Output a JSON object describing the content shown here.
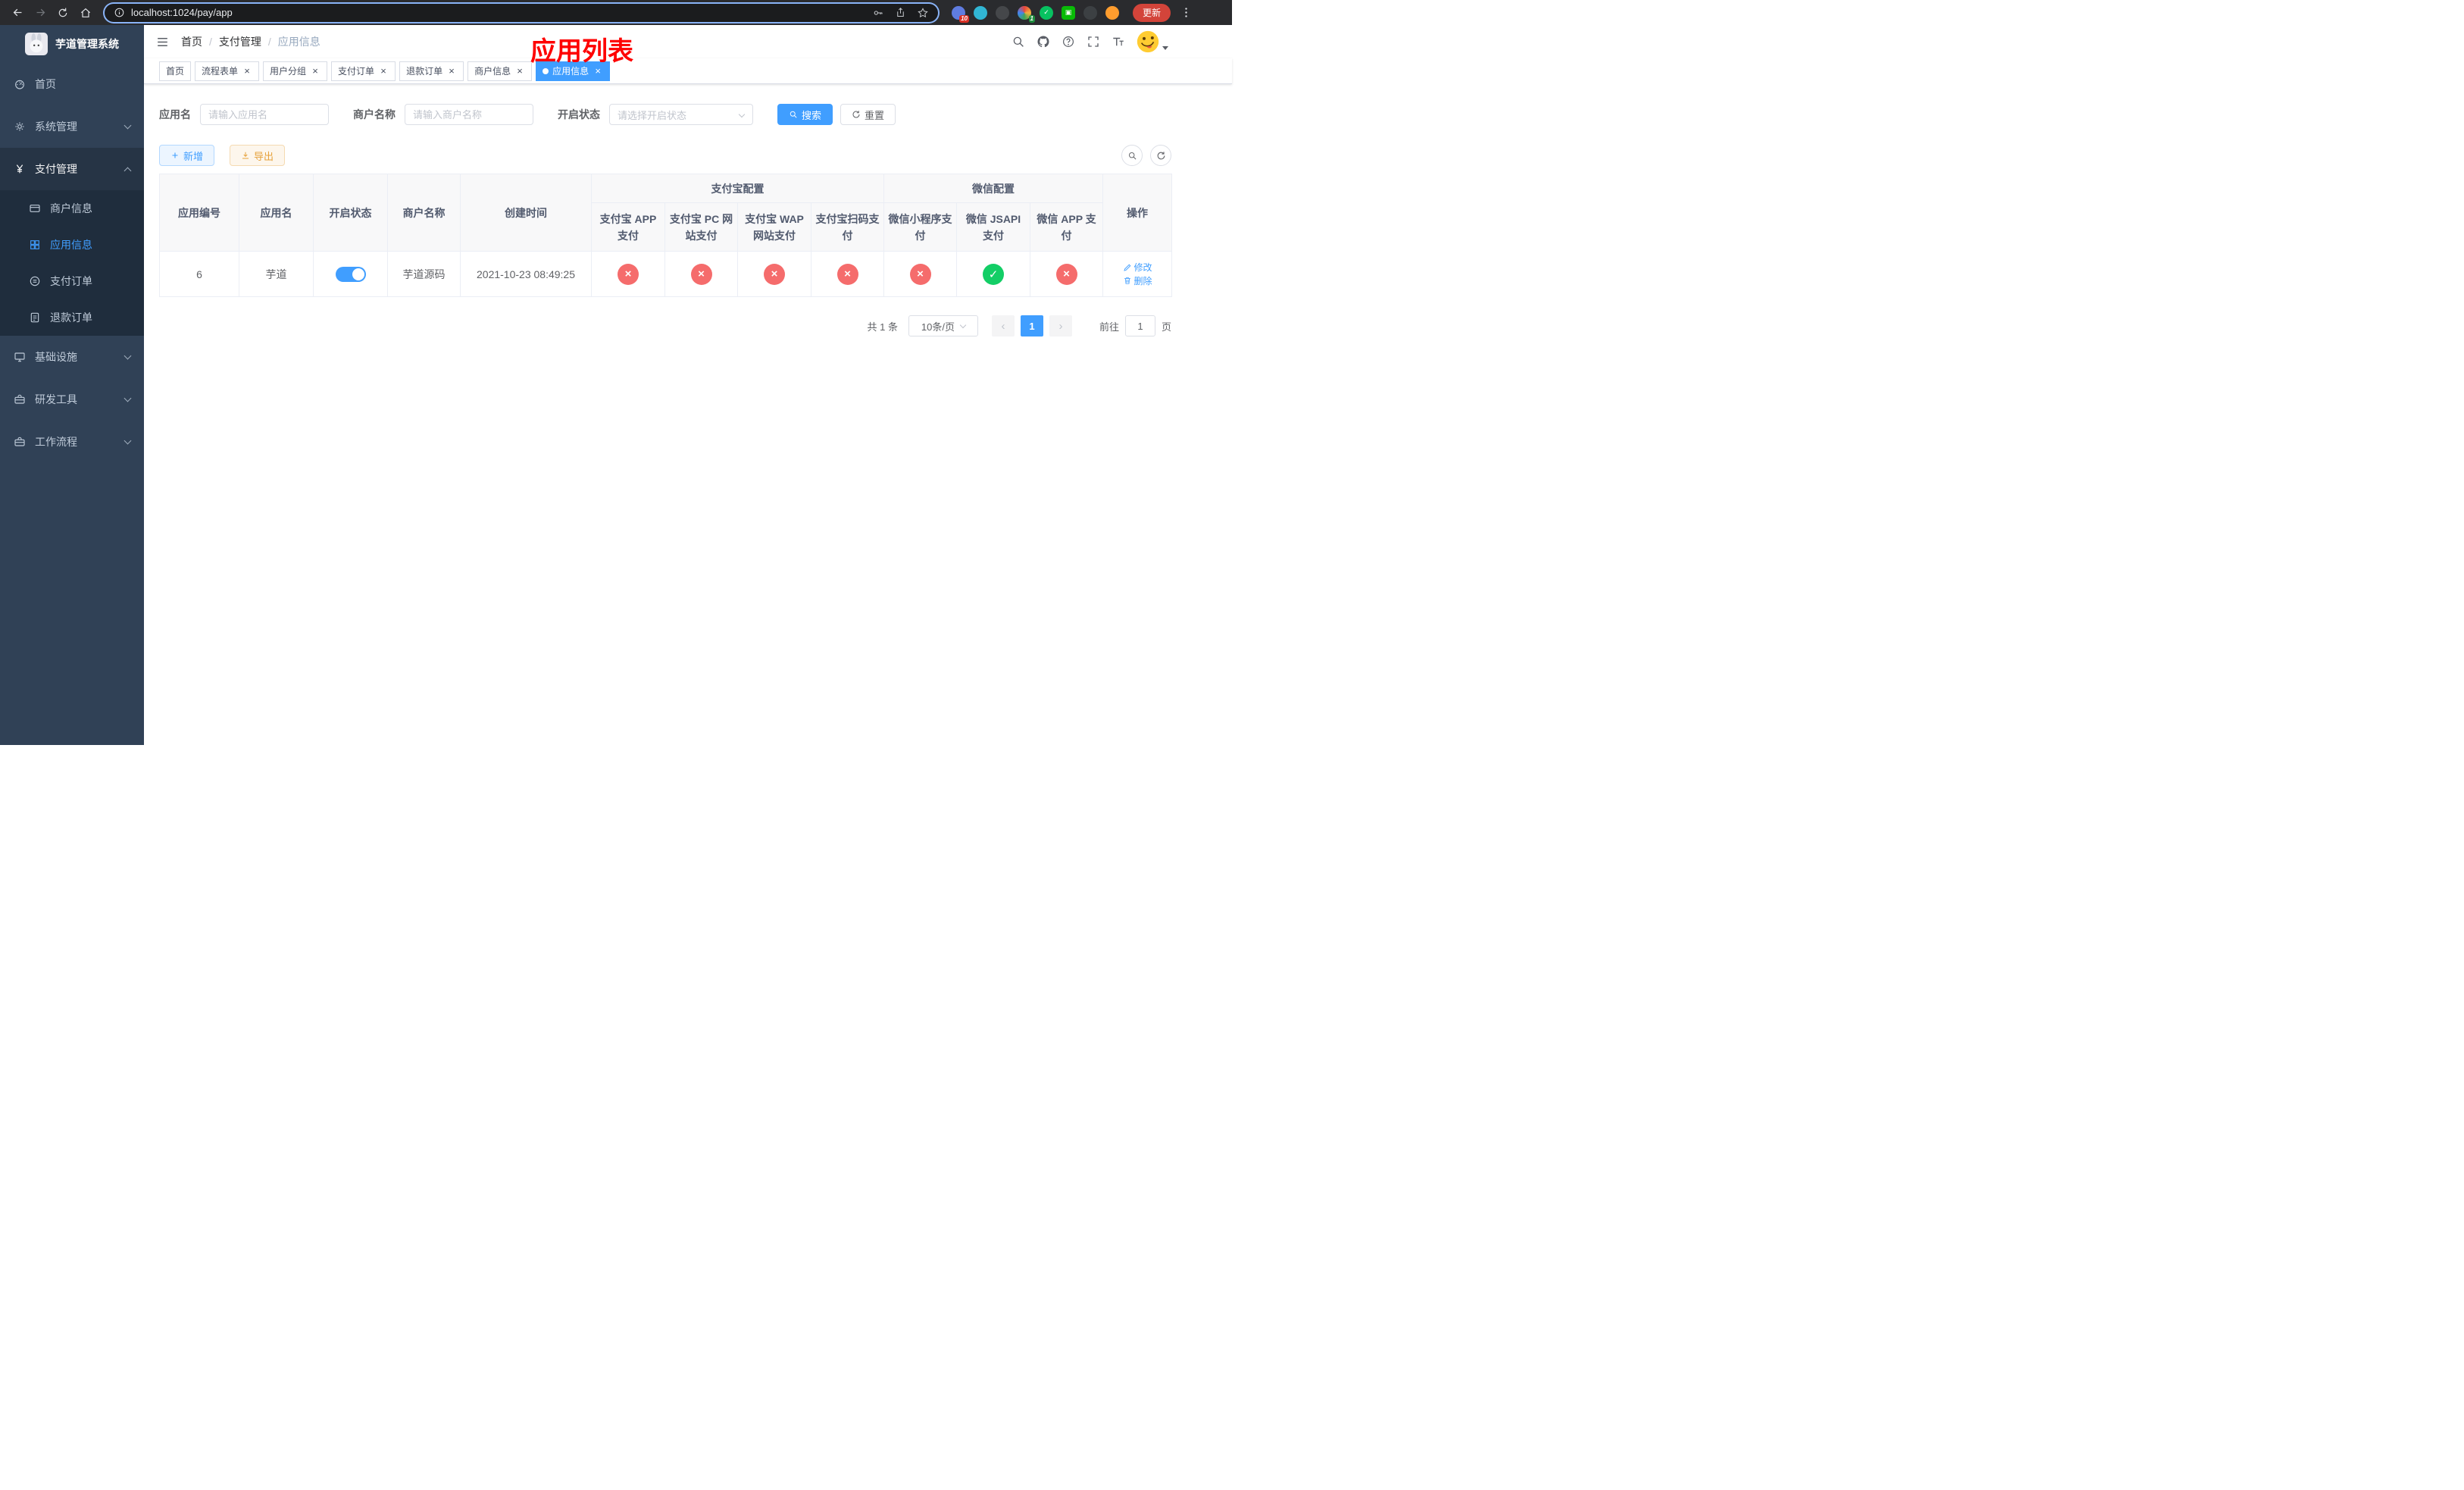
{
  "browser": {
    "url": "localhost:1024/pay/app",
    "update_label": "更新",
    "ext_badge_puzzle": "10",
    "ext_badge_avatar": "1"
  },
  "colors": {
    "primary": "#409EFF",
    "success": "#13ce66",
    "danger": "#F56C6C",
    "warning": "#E6A23C",
    "annotation": "#FE0000",
    "sidebar_bg": "#304156",
    "submenu_bg": "#1f2d3d"
  },
  "icons": {
    "close": "×",
    "check": "✓",
    "cross": "×",
    "prev": "‹",
    "next": "›"
  },
  "sidebar": {
    "title": "芋道管理系统",
    "items": {
      "home": "首页",
      "system": "系统管理",
      "payment": "支付管理",
      "infra": "基础设施",
      "devtools": "研发工具",
      "workflow": "工作流程"
    },
    "payment_children": {
      "merchant": "商户信息",
      "app": "应用信息",
      "order": "支付订单",
      "refund": "退款订单"
    }
  },
  "header": {
    "breadcrumb": [
      "首页",
      "支付管理",
      "应用信息"
    ],
    "overlay_title": "应用列表"
  },
  "tabs": [
    {
      "label": "首页",
      "closable": false,
      "active": false
    },
    {
      "label": "流程表单",
      "closable": true,
      "active": false
    },
    {
      "label": "用户分组",
      "closable": true,
      "active": false
    },
    {
      "label": "支付订单",
      "closable": true,
      "active": false
    },
    {
      "label": "退款订单",
      "closable": true,
      "active": false
    },
    {
      "label": "商户信息",
      "closable": true,
      "active": false
    },
    {
      "label": "应用信息",
      "closable": true,
      "active": true
    }
  ],
  "filters": {
    "app_name_label": "应用名",
    "app_name_placeholder": "请输入应用名",
    "merchant_label": "商户名称",
    "merchant_placeholder": "请输入商户名称",
    "status_label": "开启状态",
    "status_placeholder": "请选择开启状态",
    "search_label": "搜索",
    "reset_label": "重置"
  },
  "toolbar": {
    "add_label": "新增",
    "export_label": "导出"
  },
  "table": {
    "group_headers": {
      "alipay": "支付宝配置",
      "wechat": "微信配置"
    },
    "columns": [
      "应用编号",
      "应用名",
      "开启状态",
      "商户名称",
      "创建时间",
      "支付宝 APP 支付",
      "支付宝 PC 网站支付",
      "支付宝 WAP 网站支付",
      "支付宝扫码支付",
      "微信小程序支付",
      "微信 JSAPI 支付",
      "微信 APP 支付",
      "操作"
    ],
    "row": {
      "id": "6",
      "name": "芋道",
      "status_on": true,
      "merchant": "芋道源码",
      "created": "2021-10-23 08:49:25",
      "configs": [
        false,
        false,
        false,
        false,
        false,
        true,
        false
      ],
      "edit_label": "修改",
      "delete_label": "删除"
    }
  },
  "pagination": {
    "total_label": "共 1 条",
    "page_size": "10条/页",
    "current_page": "1",
    "goto_label": "前往",
    "goto_value": "1",
    "page_suffix": "页"
  }
}
